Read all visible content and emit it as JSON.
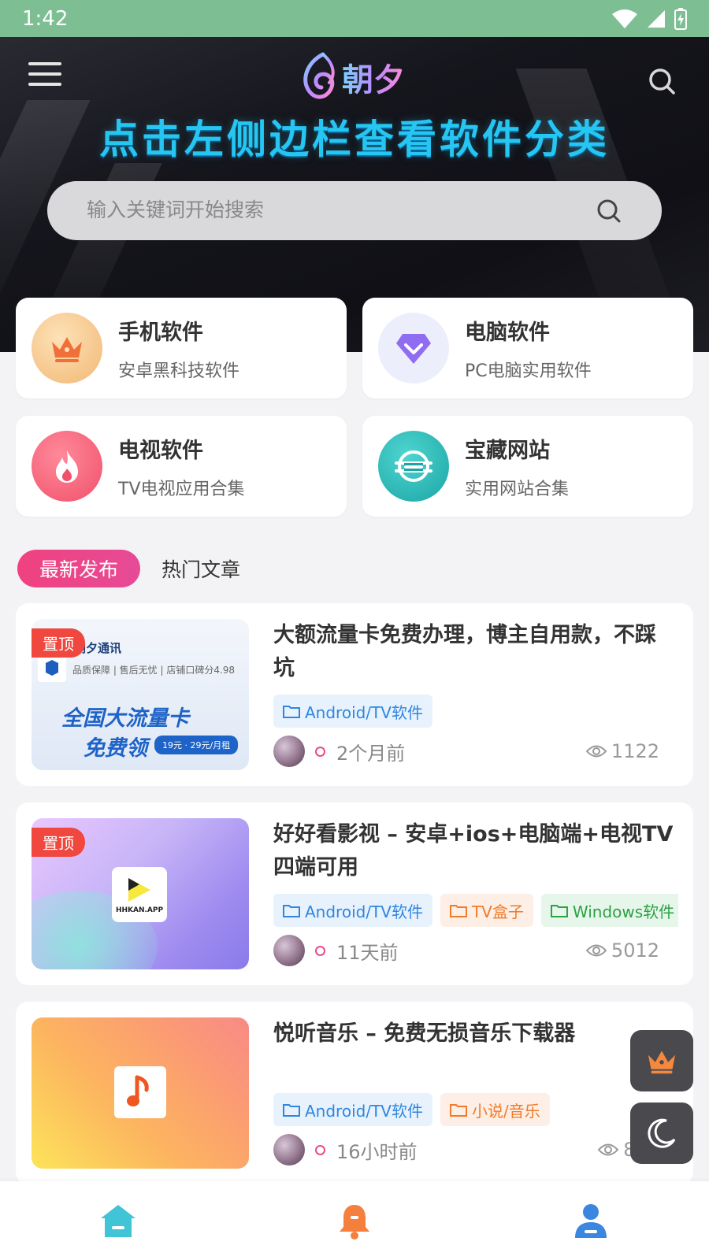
{
  "status_bar": {
    "time": "1:42"
  },
  "header": {
    "logo_text": "朝夕",
    "banner_text": "点击左侧边栏查看软件分类",
    "search_placeholder": "输入关键词开始搜索"
  },
  "categories": [
    {
      "title": "手机软件",
      "subtitle": "安卓黑科技软件",
      "icon": "crown-icon"
    },
    {
      "title": "电脑软件",
      "subtitle": "PC电脑实用软件",
      "icon": "diamond-icon"
    },
    {
      "title": "电视软件",
      "subtitle": "TV电视应用合集",
      "icon": "flame-icon"
    },
    {
      "title": "宝藏网站",
      "subtitle": "实用网站合集",
      "icon": "globe-icon"
    }
  ],
  "tabs": [
    {
      "label": "最新发布",
      "active": true
    },
    {
      "label": "热门文章",
      "active": false
    }
  ],
  "articles": [
    {
      "title": "大额流量卡免费办理，博主自用款，不踩坑",
      "pinned_label": "置顶",
      "thumb": {
        "brand": "朝夕通讯",
        "subline": "品质保障 | 售后无忧 | 店铺口碑分4.98",
        "headline1": "全国大流量卡",
        "headline2": "免费领",
        "price": "19元 · 29元/月租"
      },
      "tags": [
        {
          "label": "Android/TV软件",
          "color": "blue"
        }
      ],
      "time": "2个月前",
      "views": "1122"
    },
    {
      "title": "好好看影视 – 安卓+ios+电脑端+电视TV四端可用",
      "pinned_label": "置顶",
      "thumb": {
        "app_label": "HHKAN.APP"
      },
      "tags": [
        {
          "label": "Android/TV软件",
          "color": "blue"
        },
        {
          "label": "TV盒子",
          "color": "orange"
        },
        {
          "label": "Windows软件",
          "color": "green"
        }
      ],
      "time": "11天前",
      "views": "5012"
    },
    {
      "title": "悦听音乐 – 免费无损音乐下载器",
      "thumb": {
        "icon": "music-note-icon"
      },
      "tags": [
        {
          "label": "Android/TV软件",
          "color": "blue"
        },
        {
          "label": "小说/音乐",
          "color": "orange"
        }
      ],
      "time": "16小时前",
      "views": "870"
    }
  ],
  "floating_buttons": [
    "crown-icon",
    "moon-icon"
  ],
  "bottom_nav": [
    "home-icon",
    "bell-icon",
    "user-icon"
  ],
  "colors": {
    "status_bar": "#7dbf93",
    "accent_pink": "#f0417f",
    "banner_cyan": "#25c6f2",
    "tag_blue": "#2f86e0",
    "tag_orange": "#f07b2a",
    "tag_green": "#2da145"
  }
}
